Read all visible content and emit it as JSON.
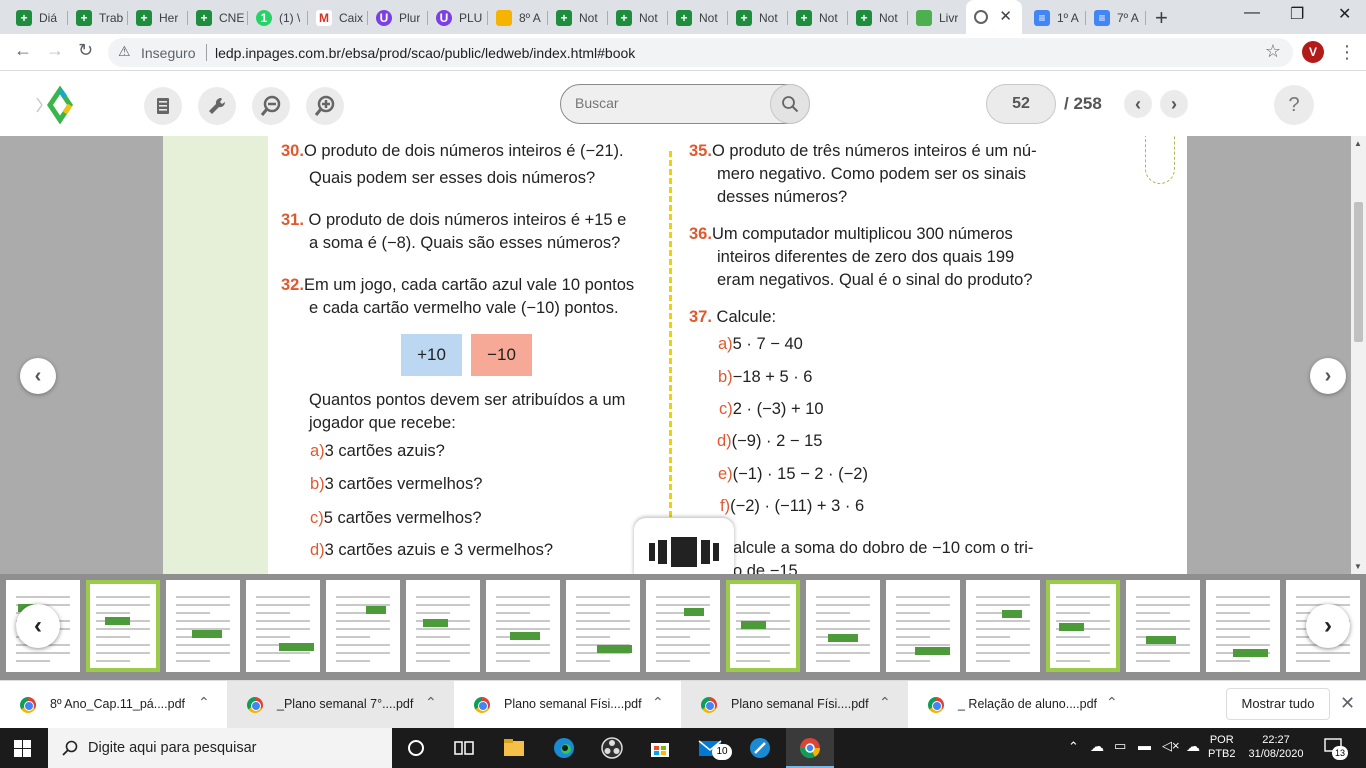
{
  "tabs": [
    {
      "label": "Diá",
      "icon": "google-classroom-icon",
      "color": "#1e8e3e"
    },
    {
      "label": "Trab",
      "icon": "google-classroom-icon",
      "color": "#1e8e3e"
    },
    {
      "label": "Her",
      "icon": "google-classroom-icon",
      "color": "#1e8e3e"
    },
    {
      "label": "CNE",
      "icon": "google-classroom-icon",
      "color": "#1e8e3e"
    },
    {
      "label": "(1) \\",
      "icon": "whatsapp-icon",
      "color": "#25d366",
      "badge": "1"
    },
    {
      "label": "Caix",
      "icon": "gmail-icon",
      "color": "#d93025",
      "badge": "M"
    },
    {
      "label": "Plur",
      "icon": "plurall-icon",
      "color": "#7b3fe4",
      "badge": "U"
    },
    {
      "label": "PLU",
      "icon": "plurall-icon",
      "color": "#7b3fe4",
      "badge": "U"
    },
    {
      "label": "8º A",
      "icon": "google-slides-icon",
      "color": "#f4b400"
    },
    {
      "label": "Not",
      "icon": "google-classroom-icon",
      "color": "#1e8e3e"
    },
    {
      "label": "Not",
      "icon": "google-classroom-icon",
      "color": "#1e8e3e"
    },
    {
      "label": "Not",
      "icon": "google-classroom-icon",
      "color": "#1e8e3e"
    },
    {
      "label": "Not",
      "icon": "google-classroom-icon",
      "color": "#1e8e3e"
    },
    {
      "label": "Not",
      "icon": "google-classroom-icon",
      "color": "#1e8e3e"
    },
    {
      "label": "Not",
      "icon": "google-classroom-icon",
      "color": "#1e8e3e"
    },
    {
      "label": "Livr",
      "icon": "livro-digital-icon",
      "color": "#4caf50"
    },
    {
      "label": "",
      "icon": "globe-icon",
      "color": "#5f6368",
      "active": true
    },
    {
      "label": "1º A",
      "icon": "google-docs-icon",
      "color": "#4285f4"
    },
    {
      "label": "7º A",
      "icon": "google-docs-icon",
      "color": "#4285f4"
    }
  ],
  "address": {
    "security": "Inseguro",
    "url": "ledp.inpages.com.br/ebsa/prod/scao/public/ledweb/index.html#book",
    "profile_initial": "V"
  },
  "reader": {
    "search_placeholder": "Buscar",
    "current_page": "52",
    "total_pages": "/ 258",
    "help": "?"
  },
  "book": {
    "left_column": [
      {
        "num": "30.",
        "lines": [
          "O produto de dois números inteiros é (−21).",
          "Quais podem ser esses dois números?"
        ]
      },
      {
        "num": "31.",
        "lines": [
          "O produto de dois números inteiros é +15 e",
          "a soma é (−8). Quais são esses números?"
        ]
      },
      {
        "num": "32.",
        "lines": [
          "Em um jogo, cada cartão azul vale 10 pontos",
          "e cada cartão vermelho vale (−10) pontos."
        ]
      }
    ],
    "cards": [
      {
        "label": "+10",
        "color": "#bcd7f2"
      },
      {
        "label": "−10",
        "color": "#f6a996"
      }
    ],
    "q32_prompt": [
      "Quantos pontos devem ser atribuídos a um",
      "jogador que recebe:"
    ],
    "q32_items": [
      {
        "letter": "a)",
        "text": "3 cartões azuis?"
      },
      {
        "letter": "b)",
        "text": "3 cartões vermelhos?"
      },
      {
        "letter": "c)",
        "text": "5 cartões vermelhos?"
      },
      {
        "letter": "d)",
        "text": "3 cartões azuis e 3 vermelhos?"
      }
    ],
    "right_column": [
      {
        "num": "35.",
        "lines": [
          "O produto de três números inteiros é um nú-",
          "mero negativo. Como podem ser os sinais",
          "desses números?"
        ]
      },
      {
        "num": "36.",
        "lines": [
          "Um computador multiplicou 300 números",
          "inteiros diferentes de zero dos quais 199",
          "eram negativos. Qual é o sinal do produto?"
        ]
      },
      {
        "num": "37.",
        "lines": [
          "Calcule:"
        ]
      }
    ],
    "q37_items": [
      {
        "letter": "a)",
        "text": "5 · 7 − 40"
      },
      {
        "letter": "b)",
        "text": "−18 + 5 · 6"
      },
      {
        "letter": "c)",
        "text": "2 · (−3) + 10"
      },
      {
        "letter": "d)",
        "text": "(−9) · 2 − 15"
      },
      {
        "letter": "e)",
        "text": "(−1) · 15 − 2 · (−2)"
      },
      {
        "letter": "f)",
        "text": "(−2) · (−11) + 3 · 6"
      }
    ],
    "q38_partial": [
      "alcule a soma do dobro de −10 com o tri-",
      "o de −15"
    ]
  },
  "downloads": [
    {
      "name": "8º Ano_Cap.11_pá....pdf"
    },
    {
      "name": "_Plano semanal 7°....pdf"
    },
    {
      "name": "Plano semanal Físi....pdf"
    },
    {
      "name": "Plano semanal Físi....pdf"
    },
    {
      "name": "_ Relação de aluno....pdf"
    }
  ],
  "shelf": {
    "show_all": "Mostrar tudo"
  },
  "taskbar": {
    "search_placeholder": "Digite aqui para pesquisar",
    "mail_badge": "10",
    "lang": "POR",
    "layout": "PTB2",
    "time": "22:27",
    "date": "31/08/2020",
    "notifications": "13"
  }
}
